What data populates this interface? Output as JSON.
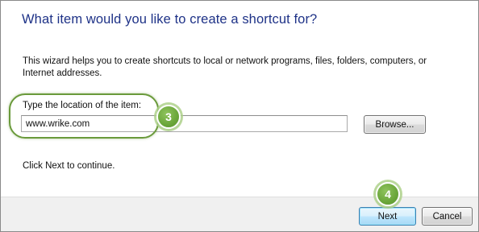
{
  "wizard": {
    "title": "What item would you like to create a shortcut for?",
    "description": "This wizard helps you to create shortcuts to local or network programs, files, folders, computers, or Internet addresses.",
    "location_label": "Type the location of the item:",
    "location_value": "www.wrike.com",
    "browse_label": "Browse...",
    "hint": "Click Next to continue."
  },
  "footer": {
    "next_label": "Next",
    "cancel_label": "Cancel"
  },
  "annotations": {
    "step_location": "3",
    "step_next": "4",
    "accent_color": "#6aa63a"
  },
  "colors": {
    "title": "#1e3287",
    "footer_background": "#f0f0f0"
  }
}
